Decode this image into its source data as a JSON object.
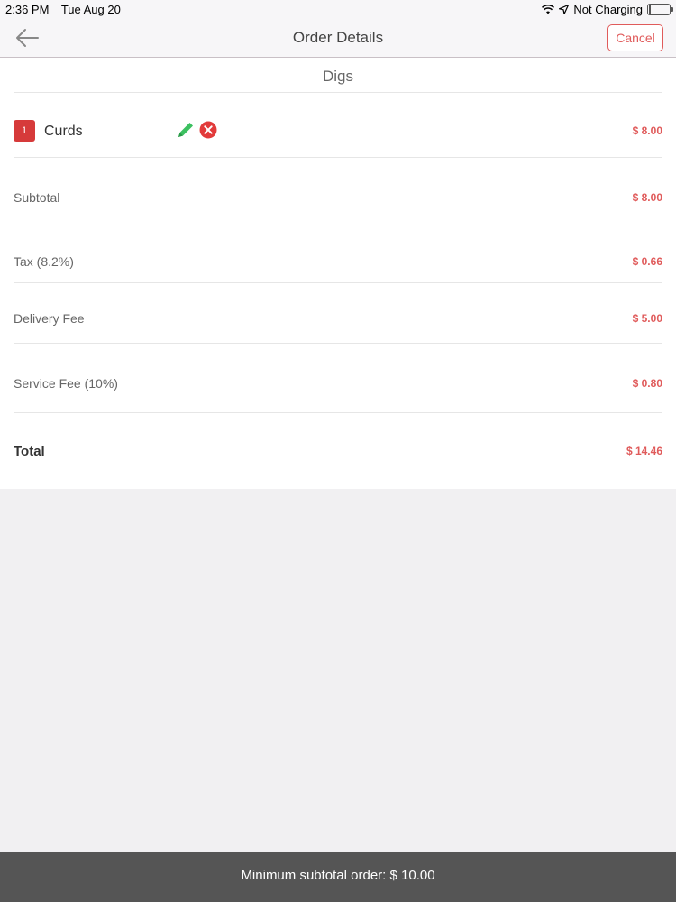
{
  "status_bar": {
    "time": "2:36 PM",
    "date": "Tue Aug 20",
    "charging": "Not Charging"
  },
  "nav": {
    "title": "Order Details",
    "cancel_label": "Cancel"
  },
  "restaurant": {
    "name": "Digs"
  },
  "item": {
    "quantity": "1",
    "name": "Curds",
    "price": "$ 8.00"
  },
  "summary": {
    "subtotal_label": "Subtotal",
    "subtotal_value": "$ 8.00",
    "tax_label": "Tax (8.2%)",
    "tax_value": "$ 0.66",
    "delivery_label": "Delivery Fee",
    "delivery_value": "$ 5.00",
    "service_label": "Service Fee (10%)",
    "service_value": "$ 0.80",
    "total_label": "Total",
    "total_value": "$ 14.46"
  },
  "footer": {
    "message": "Minimum subtotal order: $ 10.00"
  },
  "colors": {
    "accent": "#e05b5b",
    "edit": "#3cc060",
    "remove": "#e23b3b"
  },
  "icons": [
    "back-arrow-icon",
    "wifi-icon",
    "location-icon",
    "battery-icon",
    "pencil-icon",
    "remove-circle-icon"
  ]
}
